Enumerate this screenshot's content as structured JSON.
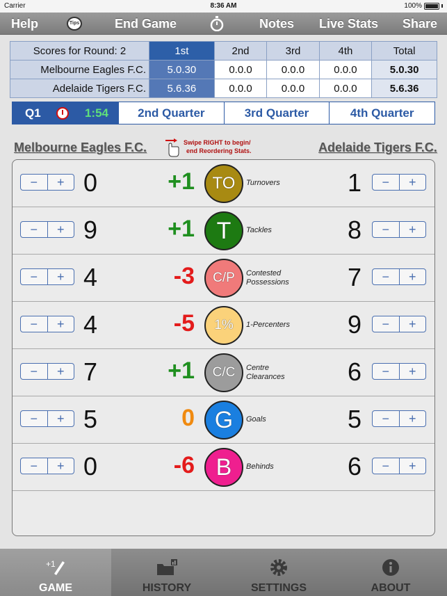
{
  "status": {
    "carrier": "Carrier",
    "time": "8:36 AM",
    "battery": "100%"
  },
  "toolbar": {
    "help": "Help",
    "tips": "Tips",
    "end_game": "End Game",
    "notes": "Notes",
    "live_stats": "Live Stats",
    "share": "Share"
  },
  "scores": {
    "caption": "Scores for Round: 2",
    "columns": [
      "1st",
      "2nd",
      "3rd",
      "4th",
      "Total"
    ],
    "rows": [
      {
        "team": "Melbourne Eagles F.C.",
        "q1": "5.0.30",
        "q2": "0.0.0",
        "q3": "0.0.0",
        "q4": "0.0.0",
        "total": "5.0.30"
      },
      {
        "team": "Adelaide Tigers F.C.",
        "q1": "5.6.36",
        "q2": "0.0.0",
        "q3": "0.0.0",
        "q4": "0.0.0",
        "total": "5.6.36"
      }
    ]
  },
  "quarters": {
    "current_label": "Q1",
    "current_time": "1:54",
    "q2": "2nd Quarter",
    "q3": "3rd Quarter",
    "q4": "4th Quarter"
  },
  "teams": {
    "home": "Melbourne Eagles F.C.",
    "away": "Adelaide Tigers F.C."
  },
  "swipe_hint": {
    "line1": "Swipe RIGHT to begin/",
    "line2": "end Reordering Stats."
  },
  "stepper": {
    "minus": "−",
    "plus": "+"
  },
  "stats": [
    {
      "abbr": "TO",
      "label1": "Turnovers",
      "label2": "",
      "home": "0",
      "diff": "+1",
      "away": "1",
      "color": "#a88a12",
      "diff_color": "#1f8f1f"
    },
    {
      "abbr": "T",
      "label1": "Tackles",
      "label2": "",
      "home": "9",
      "diff": "+1",
      "away": "8",
      "color": "#1d7a12",
      "diff_color": "#1f8f1f"
    },
    {
      "abbr": "C/P",
      "label1": "Contested",
      "label2": "Possessions",
      "home": "4",
      "diff": "-3",
      "away": "7",
      "color": "#f07a7a",
      "diff_color": "#e31b1b"
    },
    {
      "abbr": "1%",
      "label1": "1-Percenters",
      "label2": "",
      "home": "4",
      "diff": "-5",
      "away": "9",
      "color": "#fbd27a",
      "diff_color": "#e31b1b"
    },
    {
      "abbr": "C/C",
      "label1": "Centre",
      "label2": "Clearances",
      "home": "7",
      "diff": "+1",
      "away": "6",
      "color": "#9c9c9c",
      "diff_color": "#1f8f1f"
    },
    {
      "abbr": "G",
      "label1": "Goals",
      "label2": "",
      "home": "5",
      "diff": "0",
      "away": "5",
      "color": "#1a7fe0",
      "diff_color": "#f08a10"
    },
    {
      "abbr": "B",
      "label1": "Behinds",
      "label2": "",
      "home": "0",
      "diff": "-6",
      "away": "6",
      "color": "#ef1f8f",
      "diff_color": "#e31b1b"
    }
  ],
  "tabs": {
    "game": "GAME",
    "history": "HISTORY",
    "settings": "SETTINGS",
    "about": "ABOUT"
  }
}
